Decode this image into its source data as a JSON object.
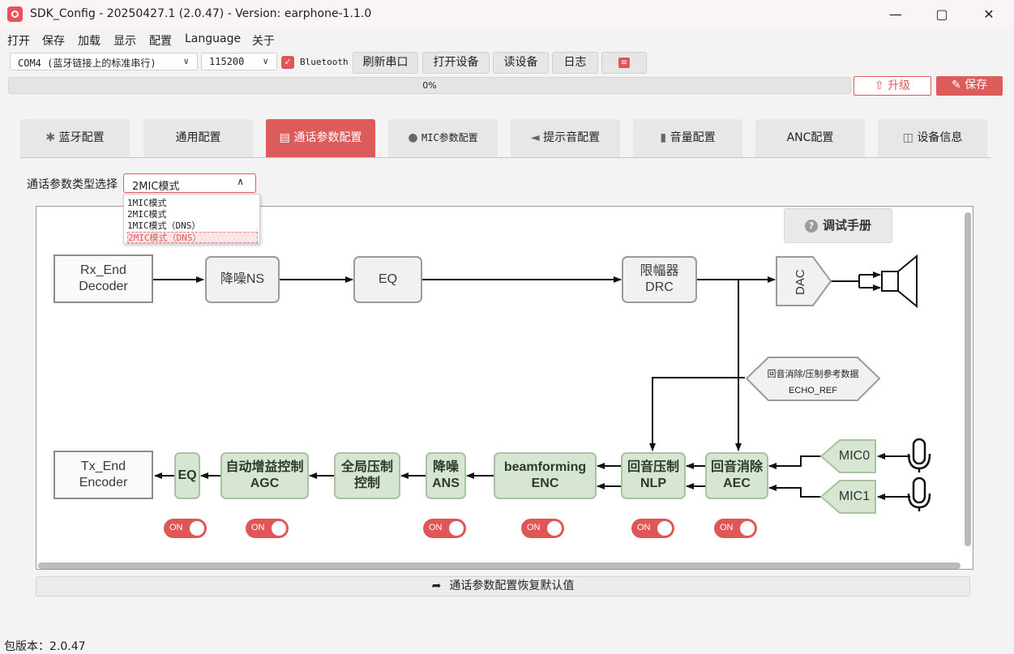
{
  "window": {
    "title": "SDK_Config -  20250427.1  (2.0.47) - Version: earphone-1.1.0"
  },
  "menu": [
    "打开",
    "保存",
    "加载",
    "显示",
    "配置",
    "Language",
    "关于"
  ],
  "toolbar": {
    "port": "COM4 (蓝牙链接上的标准串行)",
    "baud": "115200",
    "bluetooth_label": "Bluetooth",
    "bluetooth_checked": true,
    "buttons": [
      "刷新串口",
      "打开设备",
      "读设备",
      "日志"
    ]
  },
  "progress": {
    "value": 0,
    "text": "0%"
  },
  "upgrade_label": "升级",
  "save_label": "保存",
  "tabs": [
    "蓝牙配置",
    "通用配置",
    "通话参数配置",
    "MIC参数配置",
    "提示音配置",
    "音量配置",
    "ANC配置",
    "设备信息"
  ],
  "active_tab": 2,
  "selector": {
    "label": "通话参数类型选择",
    "value": "2MIC模式",
    "options": [
      "1MIC模式",
      "2MIC模式",
      "1MIC模式（DNS）",
      "2MIC模式（DNS）"
    ],
    "highlighted": 3
  },
  "help_label": "调试手册",
  "diagram": {
    "rx_end": [
      "Rx_End",
      "Decoder"
    ],
    "ns": "降噪NS",
    "eq_top": "EQ",
    "drc": [
      "限幅器",
      "DRC"
    ],
    "dac": "DAC",
    "echo_ref": [
      "回音消除/压制参考数据",
      "ECHO_REF"
    ],
    "tx_end": [
      "Tx_End",
      "Encoder"
    ],
    "eq": "EQ",
    "agc": [
      "自动增益控制",
      "AGC"
    ],
    "global_suppress": [
      "全局压制",
      "控制"
    ],
    "ans": [
      "降噪",
      "ANS"
    ],
    "enc": [
      "beamforming",
      "ENC"
    ],
    "nlp": [
      "回音压制",
      "NLP"
    ],
    "aec": [
      "回音消除",
      "AEC"
    ],
    "mic0": "MIC0",
    "mic1": "MIC1",
    "toggle_label": "ON"
  },
  "restore_label": "通话参数配置恢复默认值",
  "status": "包版本：2.0.47",
  "colors": {
    "accent": "#dc5c5c",
    "node_green": "#d6e6d0",
    "node_gray": "#f1f1f1"
  }
}
